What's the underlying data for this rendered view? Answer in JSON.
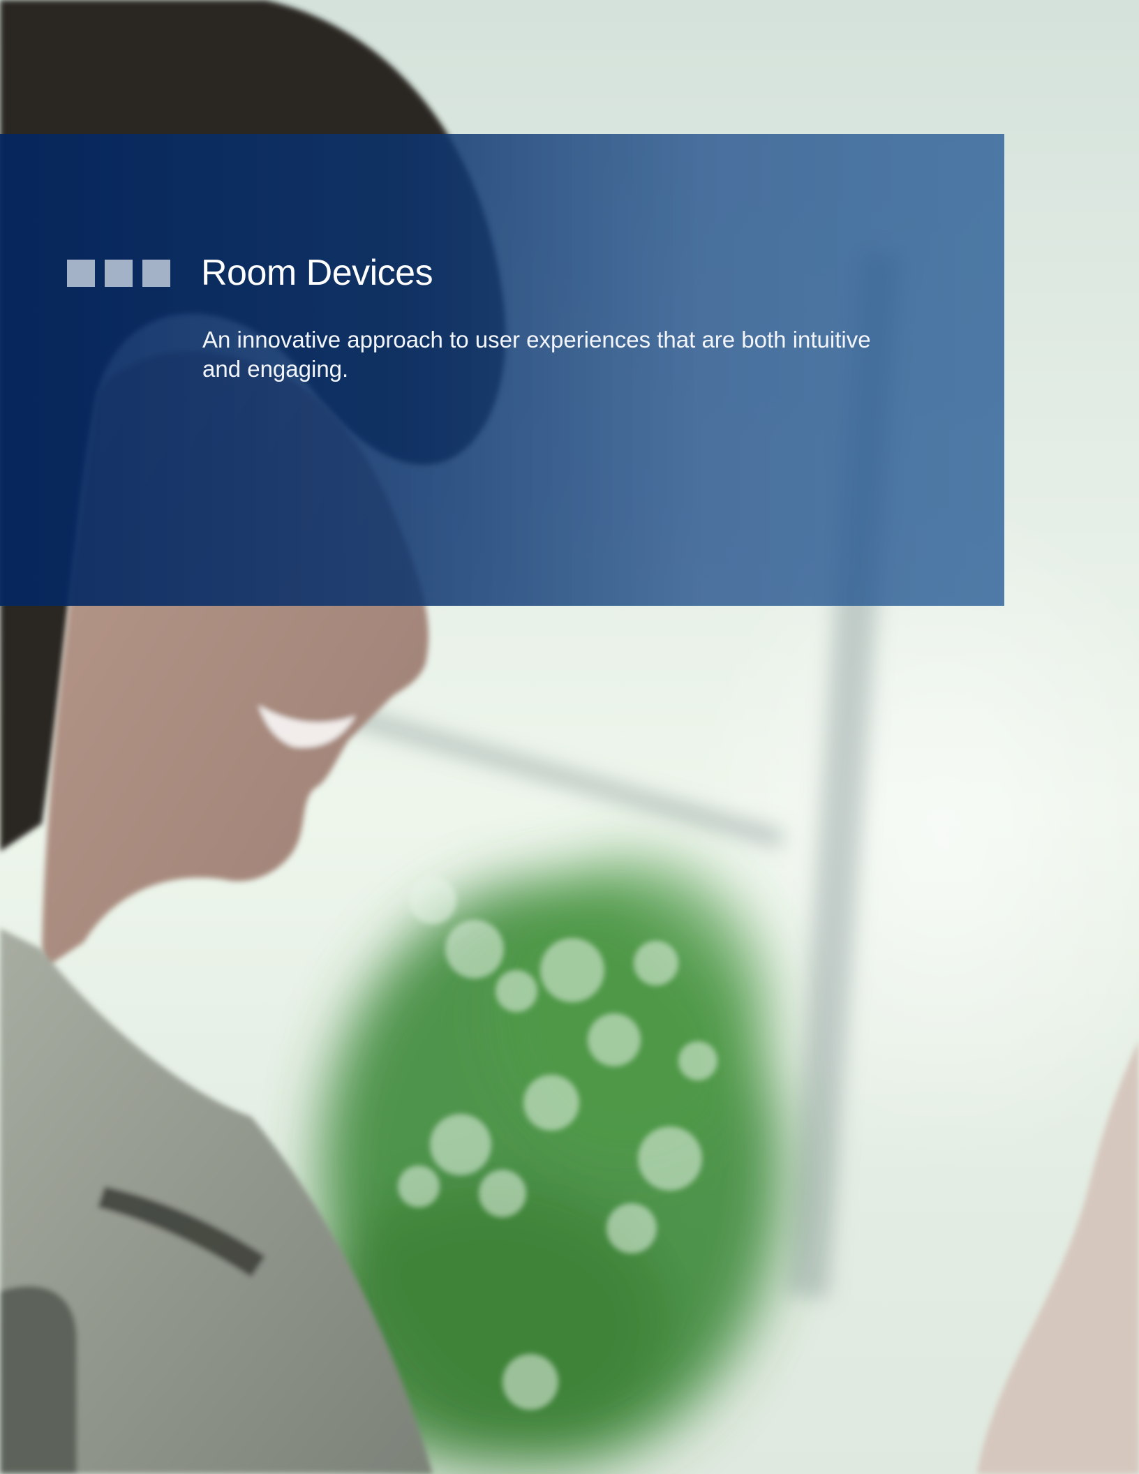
{
  "page": {
    "title": "Room Devices",
    "subtitle": "An innovative approach to user experiences that are both intuitive and engaging."
  },
  "decoration": {
    "square_count": 3,
    "square_color": "#a3b2c7",
    "panel_color": "#0a3572"
  }
}
